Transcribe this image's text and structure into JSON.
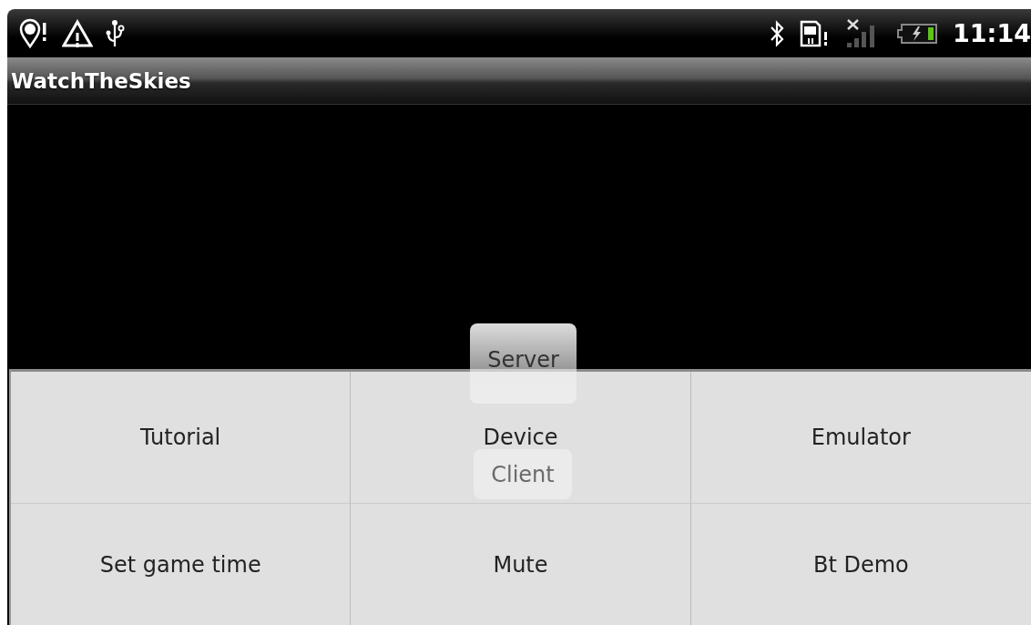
{
  "status_bar": {
    "time": "11:14"
  },
  "title_bar": {
    "title": "WatchTheSkies"
  },
  "buttons": [
    {
      "label": "Server"
    },
    {
      "label": "Client"
    }
  ],
  "menu": {
    "items": [
      {
        "label": "Tutorial"
      },
      {
        "label": "Device"
      },
      {
        "label": "Emulator"
      },
      {
        "label": "Set game time"
      },
      {
        "label": "Mute"
      },
      {
        "label": "Bt Demo"
      }
    ]
  }
}
